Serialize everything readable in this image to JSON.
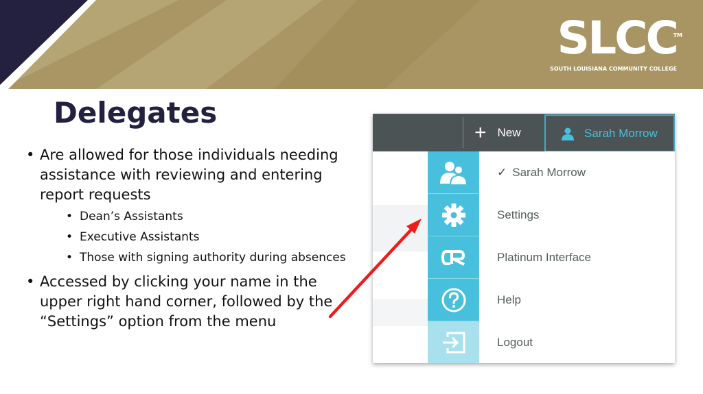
{
  "logo": {
    "name": "SLCC",
    "tm": "TM",
    "subtitle": "SOUTH LOUISIANA COMMUNITY COLLEGE"
  },
  "title": "Delegates",
  "bullets": [
    {
      "text": "Are allowed for those individuals needing assistance with reviewing and entering report requests",
      "subs": [
        "Dean’s Assistants",
        "Executive Assistants",
        "Those with signing authority during absences"
      ]
    },
    {
      "text": "Accessed by clicking your name in the upper right hand corner, followed by the “Settings” option from the menu"
    }
  ],
  "screenshot": {
    "new_label": "New",
    "user_name": "Sarah Morrow",
    "menu": [
      {
        "label": "Sarah Morrow",
        "icon": "users-icon",
        "checked": true
      },
      {
        "label": "Settings",
        "icon": "gear-icon"
      },
      {
        "label": "Platinum Interface",
        "icon": "cr-logo-icon"
      },
      {
        "label": "Help",
        "icon": "help-icon"
      },
      {
        "label": "Logout",
        "icon": "logout-icon"
      }
    ]
  },
  "colors": {
    "banner_gold": "#a89563",
    "navy": "#23213f",
    "menu_blue": "#48c0dd",
    "topbar": "#4b5355",
    "arrow_red": "#ee1c1c"
  }
}
